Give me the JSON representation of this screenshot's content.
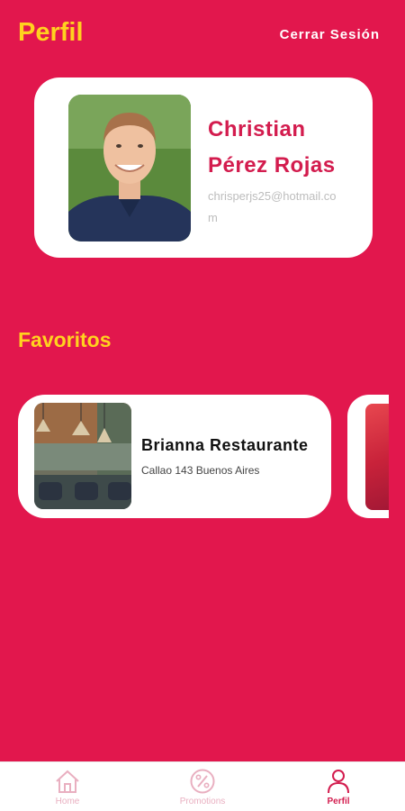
{
  "header": {
    "title": "Perfil",
    "logout_label": "Cerrar Sesión"
  },
  "profile": {
    "first_name": "Christian",
    "last_name": "Pérez Rojas",
    "email": "chrisperjs25@hotmail.com"
  },
  "favorites": {
    "title": "Favoritos",
    "items": [
      {
        "name": "Brianna Restaurante",
        "address": "Callao 143 Buenos Aires"
      }
    ]
  },
  "nav": {
    "items": [
      {
        "label": "Home",
        "icon": "home-icon",
        "active": false
      },
      {
        "label": "Promotions",
        "icon": "percent-icon",
        "active": false
      },
      {
        "label": "Perfil",
        "icon": "user-icon",
        "active": true
      }
    ]
  },
  "colors": {
    "background": "#E2174D",
    "accent_yellow": "#FFD21F",
    "name_red": "#D31C4E"
  }
}
